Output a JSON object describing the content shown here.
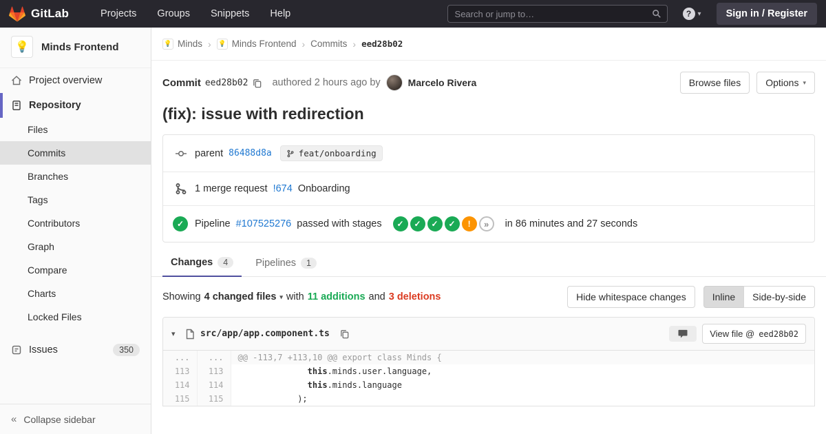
{
  "icons": {
    "question": "?",
    "caret_down": "▾",
    "crumb_sep": "›",
    "check": "✓",
    "warning": "!",
    "skipped": "»",
    "collapse": "«",
    "avatar_emoji": "💡"
  },
  "navbar": {
    "brand": "GitLab",
    "menu": [
      "Projects",
      "Groups",
      "Snippets",
      "Help"
    ],
    "search_placeholder": "Search or jump to…",
    "sign_in": "Sign in / Register"
  },
  "sidebar": {
    "project_name": "Minds Frontend",
    "project_overview": "Project overview",
    "repository": "Repository",
    "sub": [
      "Files",
      "Commits",
      "Branches",
      "Tags",
      "Contributors",
      "Graph",
      "Compare",
      "Charts",
      "Locked Files"
    ],
    "issues": "Issues",
    "issues_count": "350",
    "collapse": "Collapse sidebar"
  },
  "breadcrumb": {
    "crumbs": [
      "Minds",
      "Minds Frontend",
      "Commits"
    ],
    "current": "eed28b02"
  },
  "commit": {
    "label": "Commit",
    "sha": "eed28b02",
    "authored": "authored 2 hours ago by",
    "author": "Marcelo Rivera",
    "browse_files": "Browse files",
    "options": "Options",
    "title": "(fix): issue with redirection"
  },
  "parent_row": {
    "label": "parent",
    "sha": "86488d8a",
    "branch": "feat/onboarding"
  },
  "mr_row": {
    "text": "1 merge request",
    "link": "!674",
    "name": "Onboarding"
  },
  "pipeline_row": {
    "label": "Pipeline",
    "id": "#107525276",
    "status": "passed with stages",
    "duration": "in 86 minutes and 27 seconds"
  },
  "tabs": {
    "changes": "Changes",
    "changes_badge": "4",
    "pipelines": "Pipelines",
    "pipelines_badge": "1"
  },
  "diff_controls": {
    "showing": "Showing",
    "files_dropdown": "4 changed files",
    "with_word": "with",
    "additions": "11 additions",
    "and_word": "and",
    "deletions": "3 deletions",
    "hide_ws": "Hide whitespace changes",
    "inline": "Inline",
    "side_by_side": "Side-by-side"
  },
  "file": {
    "path": "src/app/app.component.ts",
    "view_prefix": "View file @",
    "view_sha": "eed28b02",
    "hunk_marker": "...",
    "hunk": "@@ -113,7 +113,10 @@ export class Minds {",
    "lines": [
      {
        "old": "113",
        "new": "113",
        "pre": "              ",
        "kw": "this",
        "post": ".minds.user.language,"
      },
      {
        "old": "114",
        "new": "114",
        "pre": "              ",
        "kw": "this",
        "post": ".minds.language"
      },
      {
        "old": "115",
        "new": "115",
        "pre": "            ",
        "kw": "",
        "post": ");"
      }
    ]
  }
}
